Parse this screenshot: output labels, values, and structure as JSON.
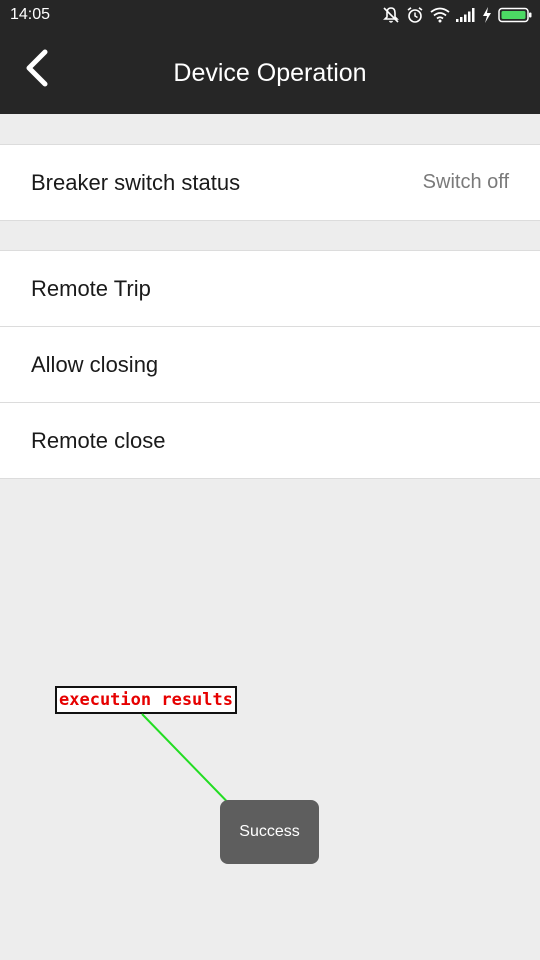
{
  "status_bar": {
    "time": "14:05",
    "icons": [
      "do-not-disturb-icon",
      "alarm-icon",
      "wifi-icon",
      "signal-icon",
      "charging-icon",
      "battery-icon"
    ]
  },
  "header": {
    "title": "Device Operation",
    "back_icon": "chevron-left-icon"
  },
  "status_section": {
    "label": "Breaker switch status",
    "value": "Switch off"
  },
  "operations": [
    {
      "label": "Remote Trip"
    },
    {
      "label": "Allow closing"
    },
    {
      "label": "Remote close"
    }
  ],
  "annotation": {
    "text": "execution results",
    "text_color": "#e60000",
    "arrow_color": "#22dd22"
  },
  "toast": {
    "text": "Success"
  },
  "colors": {
    "bar_background": "#262626",
    "page_background": "#ededed",
    "row_background": "#ffffff"
  }
}
